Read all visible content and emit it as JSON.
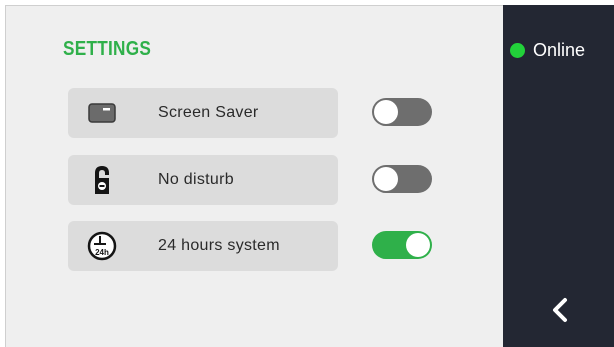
{
  "settings": {
    "title": "SETTINGS",
    "items": [
      {
        "label": "Screen Saver",
        "icon": "screen-saver-icon",
        "enabled": false
      },
      {
        "label": "No disturb",
        "icon": "do-not-disturb-icon",
        "enabled": false
      },
      {
        "label": "24 hours system",
        "icon": "clock-24h-icon",
        "enabled": true
      }
    ],
    "clock_icon_text": "24h"
  },
  "sidebar": {
    "status_label": "Online",
    "status_color": "#22d13a",
    "back_icon": "chevron-left-icon"
  },
  "colors": {
    "accent": "#2fb04a",
    "sidebar_bg": "#232733",
    "toggle_off": "#6e6e6e"
  }
}
